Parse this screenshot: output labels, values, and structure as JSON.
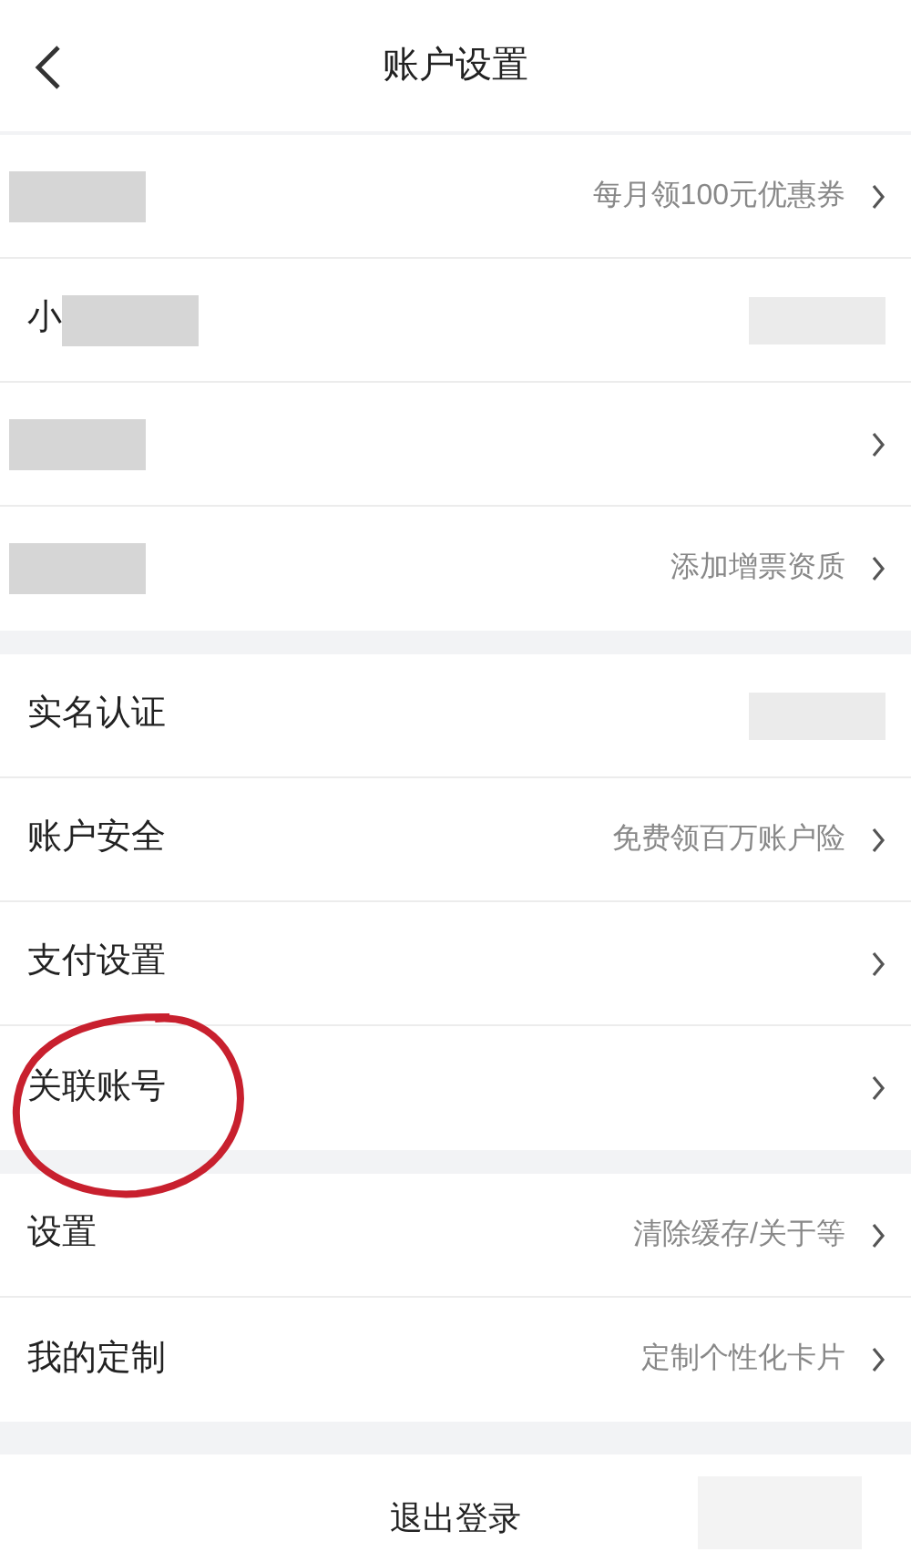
{
  "header": {
    "title": "账户设置"
  },
  "groups": [
    {
      "rows": [
        {
          "masked_label": true,
          "value": "每月领100元优惠券",
          "chevron": true
        },
        {
          "label": "小",
          "masked_label": true,
          "masked_value": true,
          "chevron": false
        },
        {
          "masked_label": true,
          "chevron": true
        },
        {
          "masked_label": true,
          "value": "添加增票资质",
          "chevron": true
        }
      ]
    },
    {
      "rows": [
        {
          "label": "实名认证",
          "masked_value": true,
          "chevron": false
        },
        {
          "label": "账户安全",
          "value": "免费领百万账户险",
          "chevron": true
        },
        {
          "label": "支付设置",
          "chevron": true
        },
        {
          "label": "关联账号",
          "chevron": true,
          "circled": true
        }
      ]
    },
    {
      "rows": [
        {
          "label": "设置",
          "value": "清除缓存/关于等",
          "chevron": true
        },
        {
          "label": "我的定制",
          "value": "定制个性化卡片",
          "chevron": true
        }
      ]
    }
  ],
  "logout": {
    "label": "退出登录",
    "masked": true
  }
}
